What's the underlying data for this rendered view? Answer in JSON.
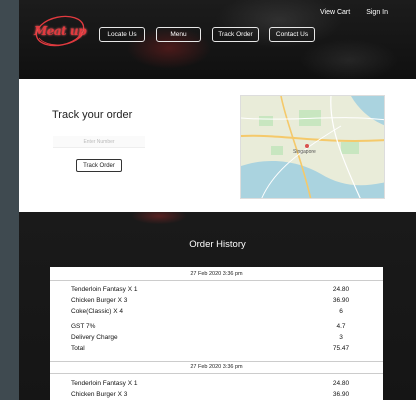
{
  "brand": {
    "logo_text": "Meat up"
  },
  "top_links": {
    "view_cart": "View Cart",
    "sign_in": "Sign In"
  },
  "nav": [
    "Locate Us",
    "Menu",
    "Track Order",
    "Contact Us"
  ],
  "track": {
    "title": "Track your order",
    "input_placeholder": "Enter Number",
    "button_label": "Track Order",
    "map_city_label": "Singapore"
  },
  "history": {
    "title": "Order History",
    "orders": [
      {
        "date": "27 Feb 2020 3:36 pm",
        "items": [
          {
            "name": "Tenderloin Fantasy  X 1",
            "price": "24.80"
          },
          {
            "name": "Chicken Burger X 3",
            "price": "36.90"
          },
          {
            "name": "Coke(Classic) X 4",
            "price": "6"
          },
          {
            "name": "GST 7%",
            "price": "4.7"
          },
          {
            "name": "Delivery Charge",
            "price": "3"
          },
          {
            "name": "Total",
            "price": "75.47"
          }
        ]
      },
      {
        "date": "27 Feb 2020 3:36 pm",
        "items": [
          {
            "name": "Tenderloin Fantasy  X 1",
            "price": "24.80"
          },
          {
            "name": "Chicken Burger X 3",
            "price": "36.90"
          }
        ]
      }
    ]
  },
  "colors": {
    "brand_red": "#e23a3f",
    "dark_bg": "#141414",
    "outer_bg": "#3f4a50"
  }
}
